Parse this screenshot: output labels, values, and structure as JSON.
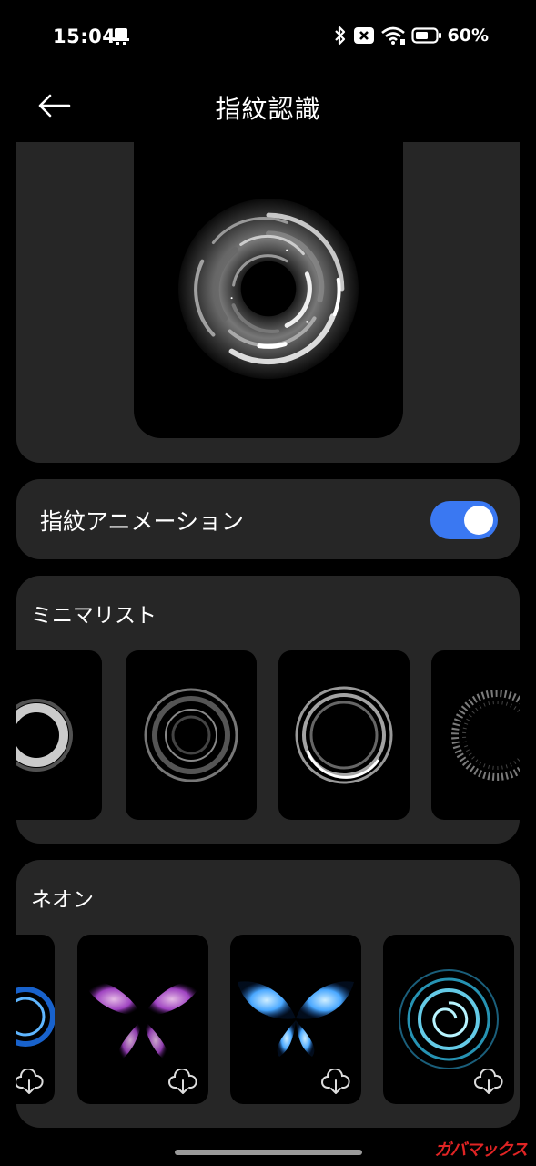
{
  "status_bar": {
    "time": "15:04",
    "battery_percent": "60%",
    "icons": [
      "notification-icon",
      "bluetooth-icon",
      "sim-off-icon",
      "wifi-icon",
      "battery-icon"
    ]
  },
  "header": {
    "title": "指紋認識",
    "back_icon": "arrow-left-icon"
  },
  "animation_toggle": {
    "label": "指紋アニメーション",
    "enabled": true,
    "accent_color": "#3a78f2"
  },
  "sections": [
    {
      "title": "ミニマリスト",
      "items": [
        "ring-glow",
        "ring-glass",
        "ring-double",
        "ring-sparkle"
      ]
    },
    {
      "title": "ネオン",
      "items": [
        "neon-blue-orb",
        "neon-purple-butterfly",
        "neon-blue-butterfly",
        "neon-cyan-vortex"
      ],
      "download_icon": "cloud-download-icon"
    }
  ],
  "watermark": "ガバマックス"
}
